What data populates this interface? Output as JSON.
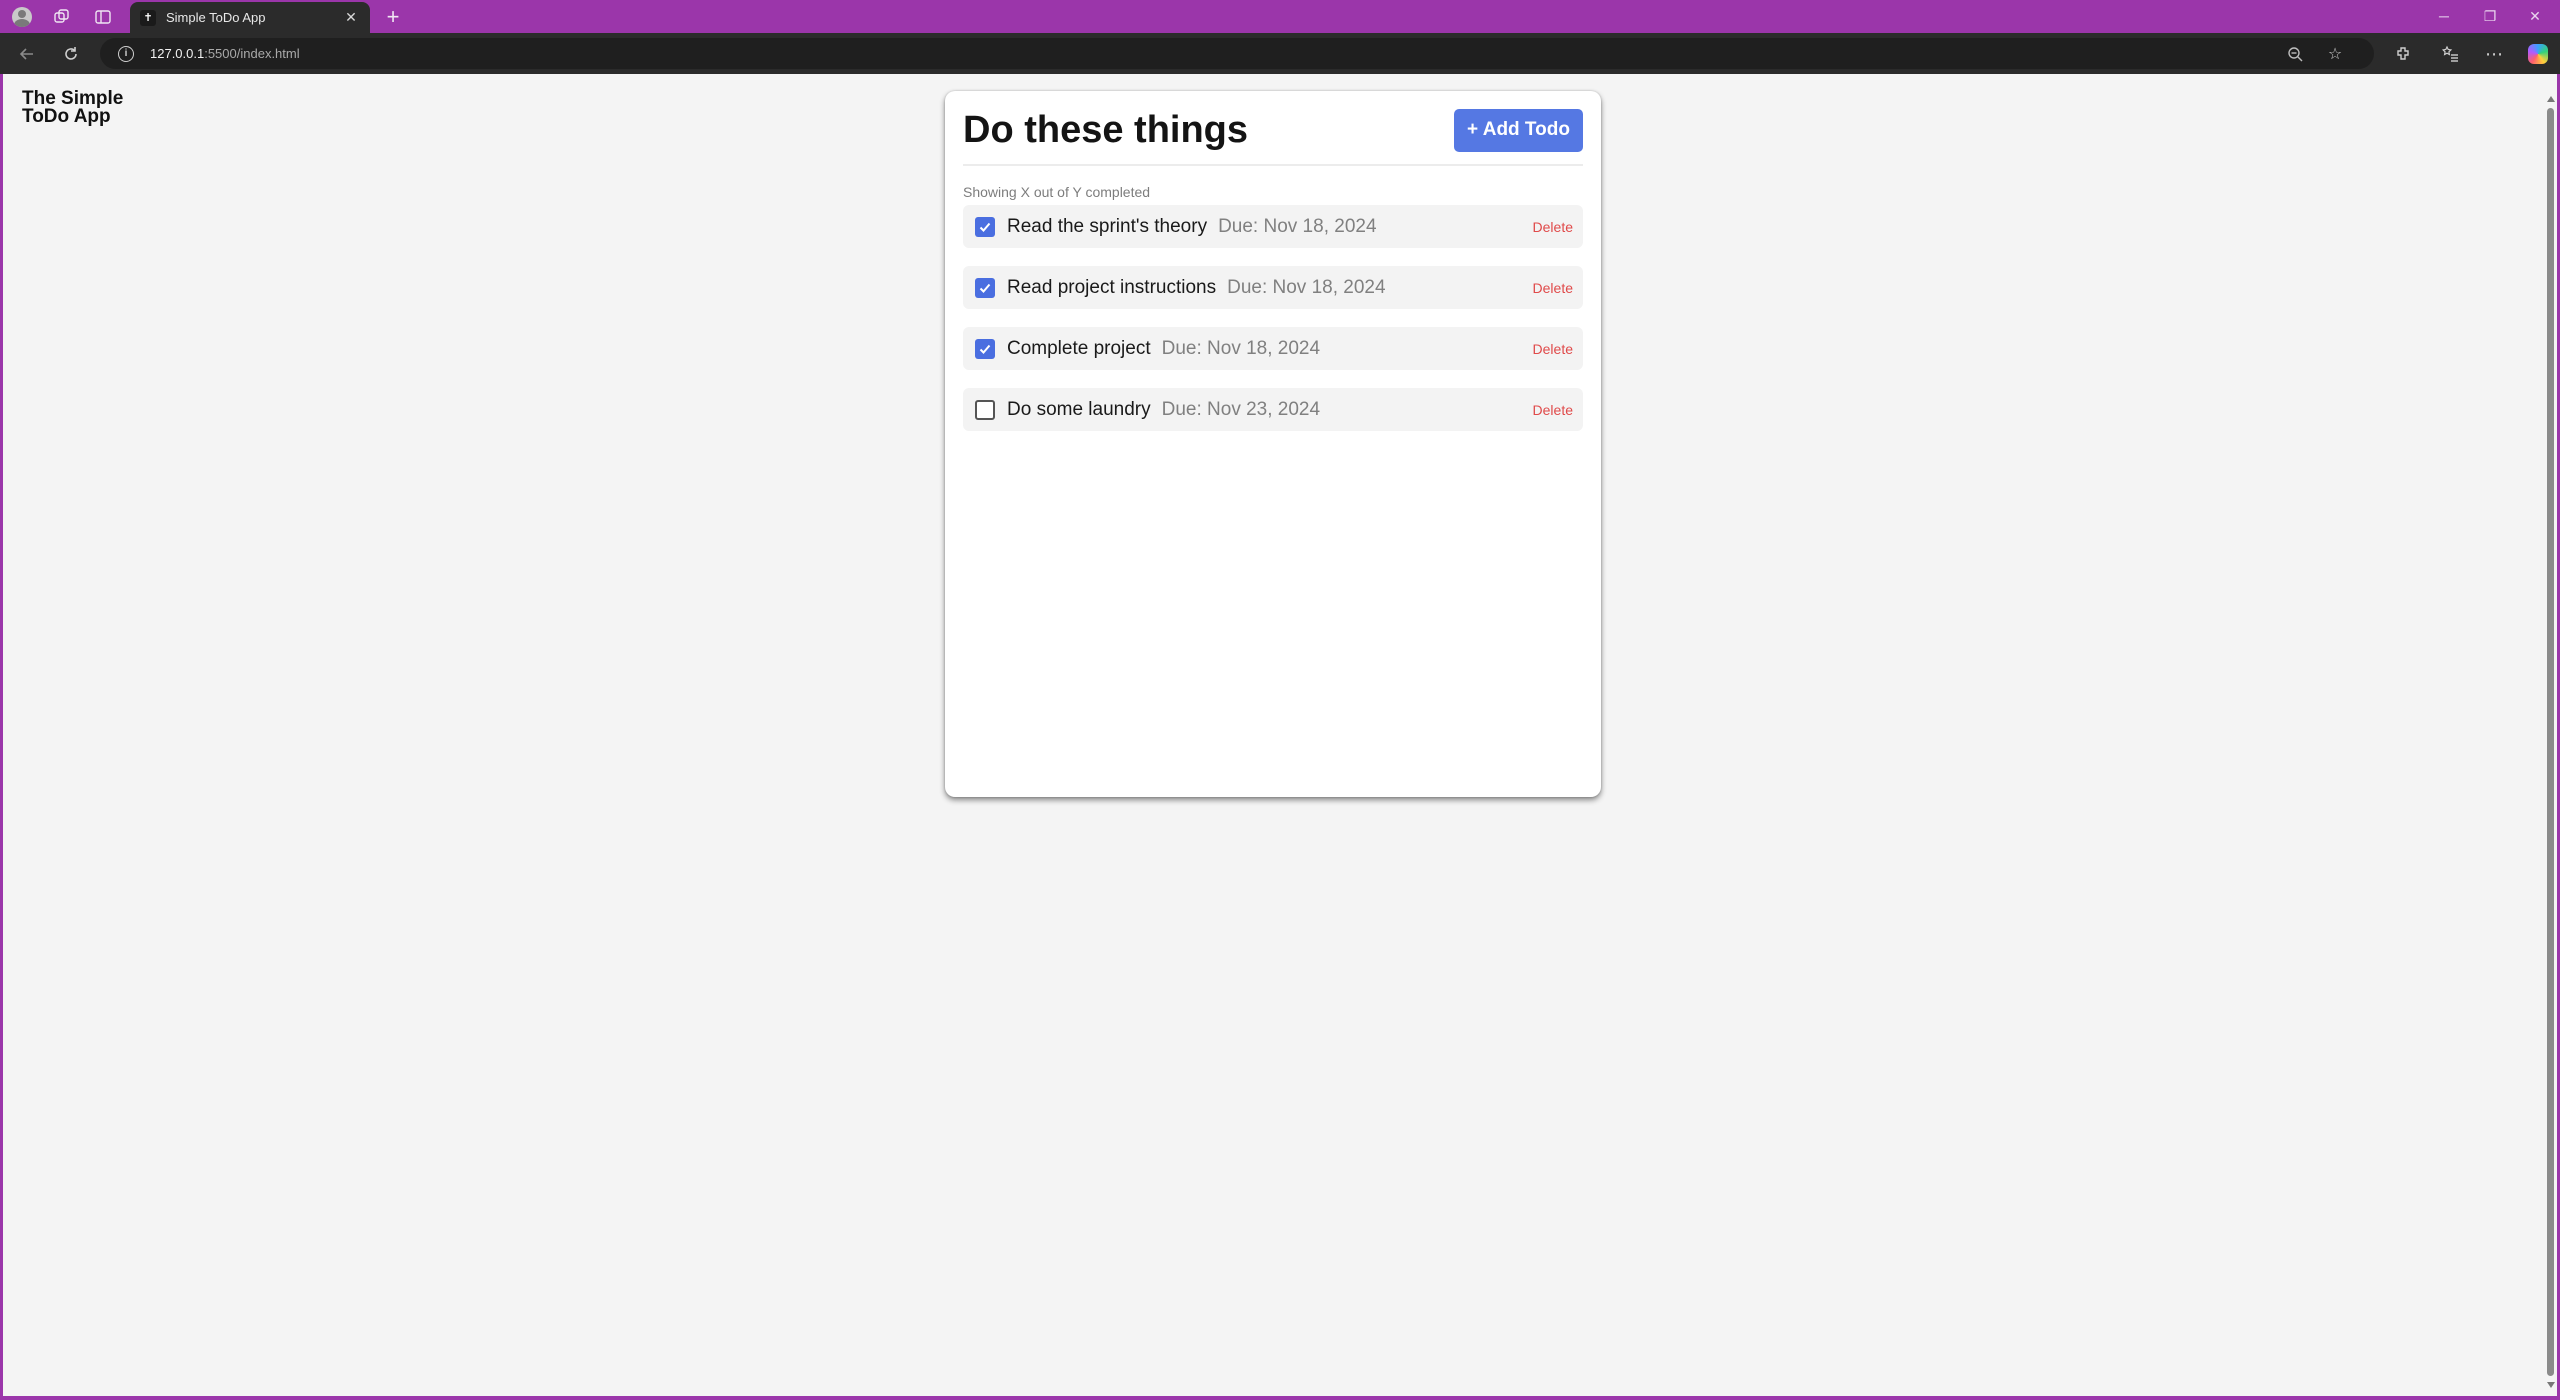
{
  "browser": {
    "tab_title": "Simple ToDo App",
    "favicon_glyph": "✝",
    "new_tab_label": "+",
    "url_host": "127.0.0.1",
    "url_rest": ":5500/index.html",
    "colors": {
      "frame": "#9b36aa",
      "toolbar": "#2b2b2b"
    }
  },
  "page": {
    "brand": "The Simple ToDo App",
    "title": "Do these things",
    "add_button_label": "+ Add Todo",
    "summary": "Showing X out of Y completed",
    "todos": [
      {
        "text": "Read the sprint's theory",
        "due": "Due: Nov 18, 2024",
        "completed": true,
        "delete_label": "Delete"
      },
      {
        "text": "Read project instructions",
        "due": "Due: Nov 18, 2024",
        "completed": true,
        "delete_label": "Delete"
      },
      {
        "text": "Complete project",
        "due": "Due: Nov 18, 2024",
        "completed": true,
        "delete_label": "Delete"
      },
      {
        "text": "Do some laundry",
        "due": "Due: Nov 23, 2024",
        "completed": false,
        "delete_label": "Delete"
      }
    ],
    "colors": {
      "accent": "#5578e3",
      "delete": "#e04a4a"
    }
  }
}
